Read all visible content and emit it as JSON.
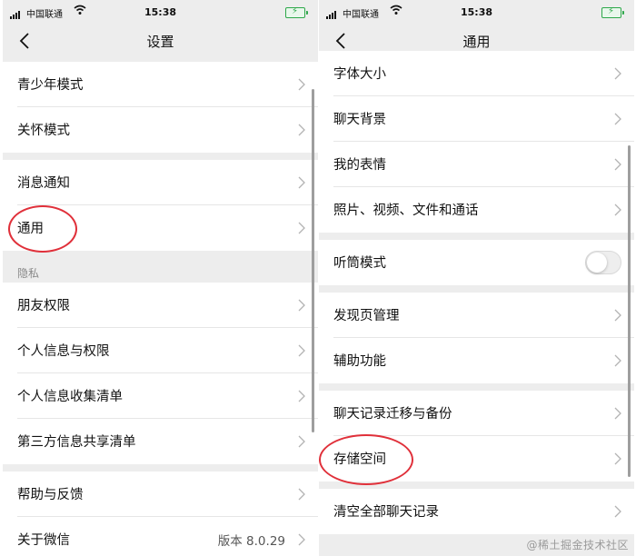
{
  "status_bar": {
    "carrier": "中国联通",
    "time": "15:38",
    "wifi_icon": "wifi-icon",
    "battery_state": "charging"
  },
  "left_panel": {
    "title": "设置",
    "back_icon": "back-chevron-icon",
    "items": {
      "youth_mode": "青少年模式",
      "care_mode": "关怀模式",
      "notifications": "消息通知",
      "general": "通用",
      "privacy_header": "隐私",
      "friend_permissions": "朋友权限",
      "personal_info_permissions": "个人信息与权限",
      "personal_info_collection": "个人信息收集清单",
      "third_party_sharing": "第三方信息共享清单",
      "help_feedback": "帮助与反馈",
      "about_wechat": "关于微信",
      "about_version": "版本 8.0.29"
    }
  },
  "right_panel": {
    "title": "通用",
    "back_icon": "back-chevron-icon",
    "items": {
      "font_size": "字体大小",
      "chat_background": "聊天背景",
      "my_stickers": "我的表情",
      "photos_videos_files_calls": "照片、视频、文件和通话",
      "earpiece_mode": "听筒模式",
      "earpiece_mode_enabled": false,
      "discover_management": "发现页管理",
      "accessibility": "辅助功能",
      "chat_history_migration": "聊天记录迁移与备份",
      "storage": "存储空间",
      "clear_all_chat_history": "清空全部聊天记录"
    }
  },
  "annotation_color": "#e0303a",
  "watermark": "@稀土掘金技术社区"
}
